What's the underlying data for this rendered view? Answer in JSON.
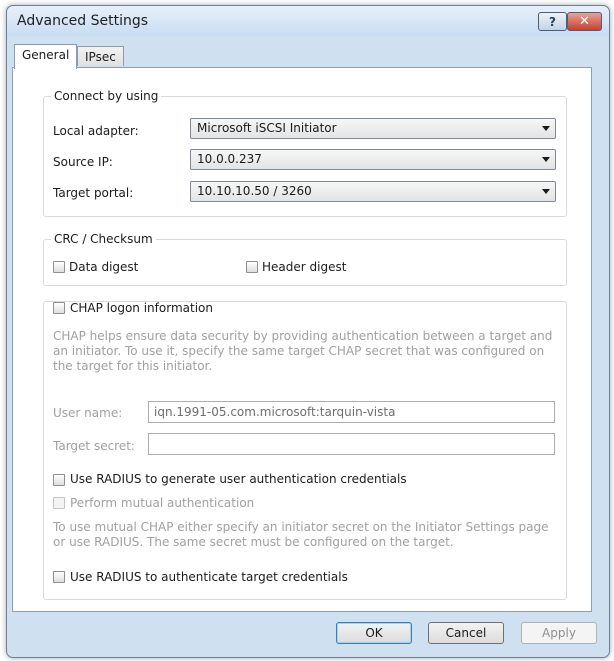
{
  "window": {
    "title": "Advanced Settings",
    "help_label": "?",
    "close_label": "✕"
  },
  "tabs": [
    {
      "label": "General",
      "active": true
    },
    {
      "label": "IPsec",
      "active": false
    }
  ],
  "connect": {
    "legend": "Connect by using",
    "local_adapter_label": "Local adapter:",
    "local_adapter_value": "Microsoft iSCSI Initiator",
    "source_ip_label": "Source IP:",
    "source_ip_value": "10.0.0.237",
    "target_portal_label": "Target portal:",
    "target_portal_value": "10.10.10.50 / 3260"
  },
  "crc": {
    "legend": "CRC / Checksum",
    "data_digest_label": "Data digest",
    "header_digest_label": "Header digest"
  },
  "chap": {
    "checkbox_label": "CHAP logon information",
    "description": "CHAP helps ensure data security by providing authentication between a target and an initiator. To use it, specify the same target CHAP secret that was configured on the target for this initiator.",
    "user_name_label": "User name:",
    "user_name_value": "iqn.1991-05.com.microsoft:tarquin-vista",
    "target_secret_label": "Target secret:",
    "target_secret_value": "",
    "radius_generate_label": "Use RADIUS to generate user authentication credentials",
    "mutual_auth_label": "Perform mutual authentication",
    "mutual_description": "To use mutual CHAP either specify an initiator secret on the Initiator Settings page or use RADIUS.  The same secret must be configured on the target.",
    "radius_target_label": "Use RADIUS to authenticate target credentials"
  },
  "buttons": {
    "ok": "OK",
    "cancel": "Cancel",
    "apply": "Apply"
  }
}
